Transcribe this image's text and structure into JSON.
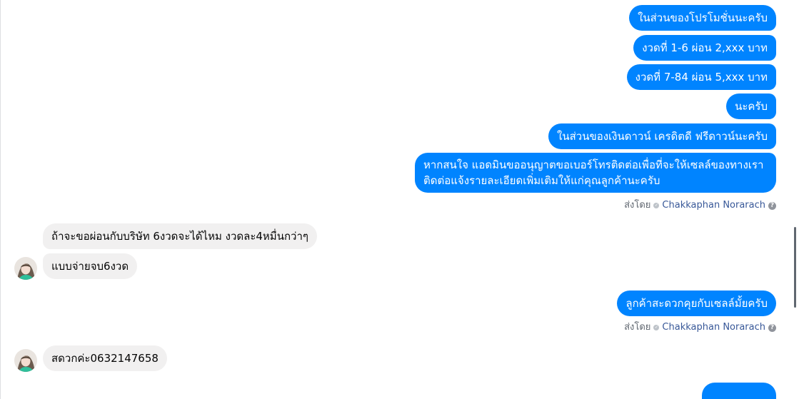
{
  "conversation": {
    "sent_group_1": [
      "ในส่วนของโปรโมชั่นนะครับ",
      "งวดที่ 1-6 ผ่อน 2,xxx บาท",
      "งวดที่ 7-84 ผ่อน 5,xxx บาท",
      "นะครับ",
      "ในส่วนของเงินดาวน์ เครดิตดี ฟรีดาวน์นะครับ",
      "หากสนใจ แอดมินขออนุญาตขอเบอร์โทรติดต่อเพื่อที่จะให้เซลล์ของทางเราติดต่อแจ้งรายละเอียดเพิ่มเติมให้แก่คุณลูกค้านะครับ"
    ],
    "sent_by_label": "ส่งโดย",
    "sent_by_name": "Chakkaphan Norarach",
    "help_glyph": "?",
    "received_group_1": [
      "ถ้าจะขอผ่อนกับบริษัท 6งวดจะได้ไหม งวดละ4หมื่นกว่าๆ",
      "แบบจ่ายจบ6งวด"
    ],
    "sent_group_2": [
      "ลูกค้าสะดวกคุยกับเซลล์มั้ยครับ"
    ],
    "received_group_2": [
      "สดวกค่ะ0632147658"
    ]
  },
  "colors": {
    "outgoing_bubble": "#0084ff",
    "incoming_bubble": "#f1f0f0",
    "author_link": "#385898"
  },
  "icons": {
    "seen_check": "check-circle-icon",
    "help": "question-circle-icon",
    "avatar": "contact-avatar"
  }
}
